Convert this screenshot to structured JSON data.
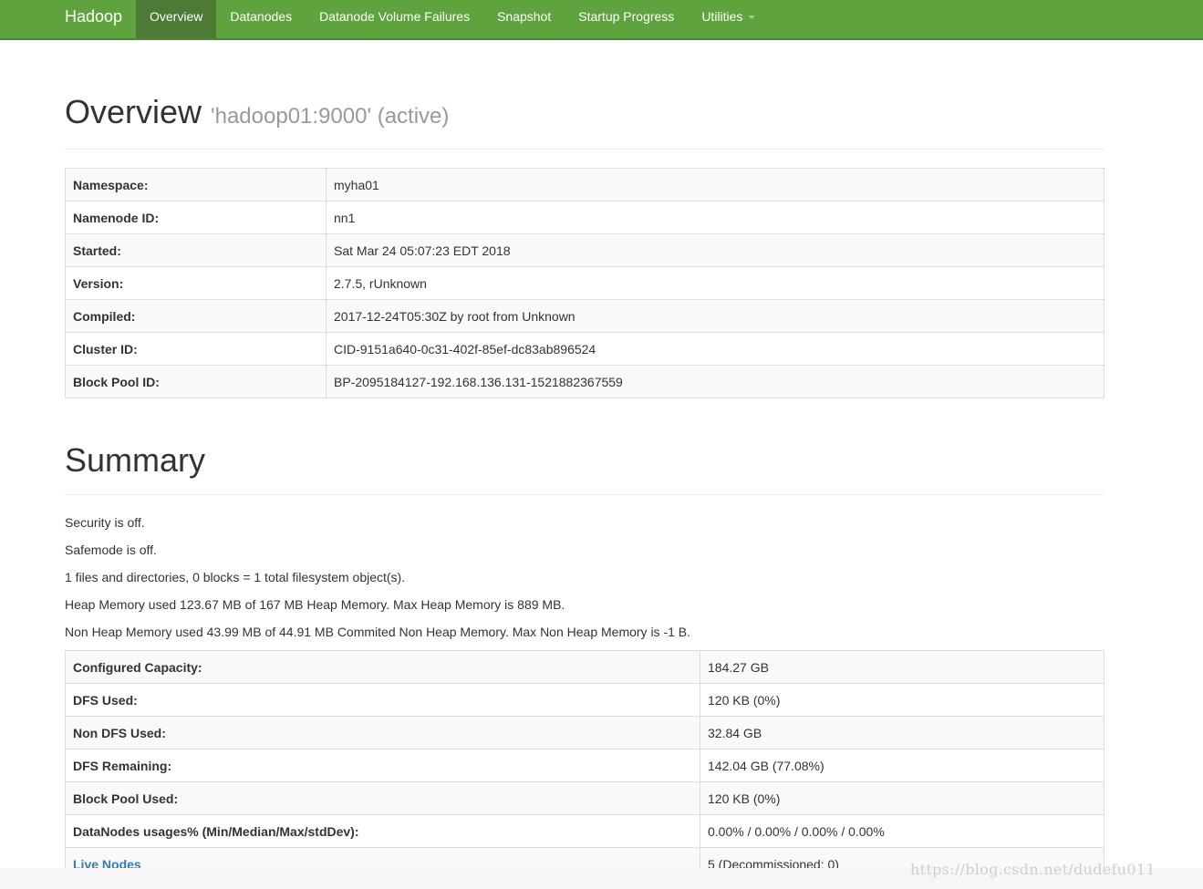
{
  "navbar": {
    "brand": "Hadoop",
    "items": [
      {
        "label": "Overview"
      },
      {
        "label": "Datanodes"
      },
      {
        "label": "Datanode Volume Failures"
      },
      {
        "label": "Snapshot"
      },
      {
        "label": "Startup Progress"
      },
      {
        "label": "Utilities"
      }
    ]
  },
  "overview": {
    "title": "Overview",
    "subtitle": "'hadoop01:9000' (active)",
    "rows": [
      {
        "key": "Namespace:",
        "value": "myha01"
      },
      {
        "key": "Namenode ID:",
        "value": "nn1"
      },
      {
        "key": "Started:",
        "value": "Sat Mar 24 05:07:23 EDT 2018"
      },
      {
        "key": "Version:",
        "value": "2.7.5, rUnknown"
      },
      {
        "key": "Compiled:",
        "value": "2017-12-24T05:30Z by root from Unknown"
      },
      {
        "key": "Cluster ID:",
        "value": "CID-9151a640-0c31-402f-85ef-dc83ab896524"
      },
      {
        "key": "Block Pool ID:",
        "value": "BP-2095184127-192.168.136.131-1521882367559"
      }
    ]
  },
  "summary": {
    "title": "Summary",
    "lines": [
      "Security is off.",
      "Safemode is off.",
      "1 files and directories, 0 blocks = 1 total filesystem object(s).",
      "Heap Memory used 123.67 MB of 167 MB Heap Memory. Max Heap Memory is 889 MB.",
      "Non Heap Memory used 43.99 MB of 44.91 MB Commited Non Heap Memory. Max Non Heap Memory is -1 B."
    ],
    "rows": [
      {
        "key": "Configured Capacity:",
        "value": "184.27 GB"
      },
      {
        "key": "DFS Used:",
        "value": "120 KB (0%)"
      },
      {
        "key": "Non DFS Used:",
        "value": "32.84 GB"
      },
      {
        "key": "DFS Remaining:",
        "value": "142.04 GB (77.08%)"
      },
      {
        "key": "Block Pool Used:",
        "value": "120 KB (0%)"
      },
      {
        "key": "DataNodes usages% (Min/Median/Max/stdDev):",
        "value": "0.00% / 0.00% / 0.00% / 0.00%"
      },
      {
        "key": "Live Nodes",
        "value": "5 (Decommissioned: 0)"
      }
    ]
  },
  "watermark": "https://blog.csdn.net/dudefu011",
  "colors": {
    "navbar_bg": "#5fa33e",
    "navbar_active": "#4c7b35",
    "link": "#337ab7"
  }
}
